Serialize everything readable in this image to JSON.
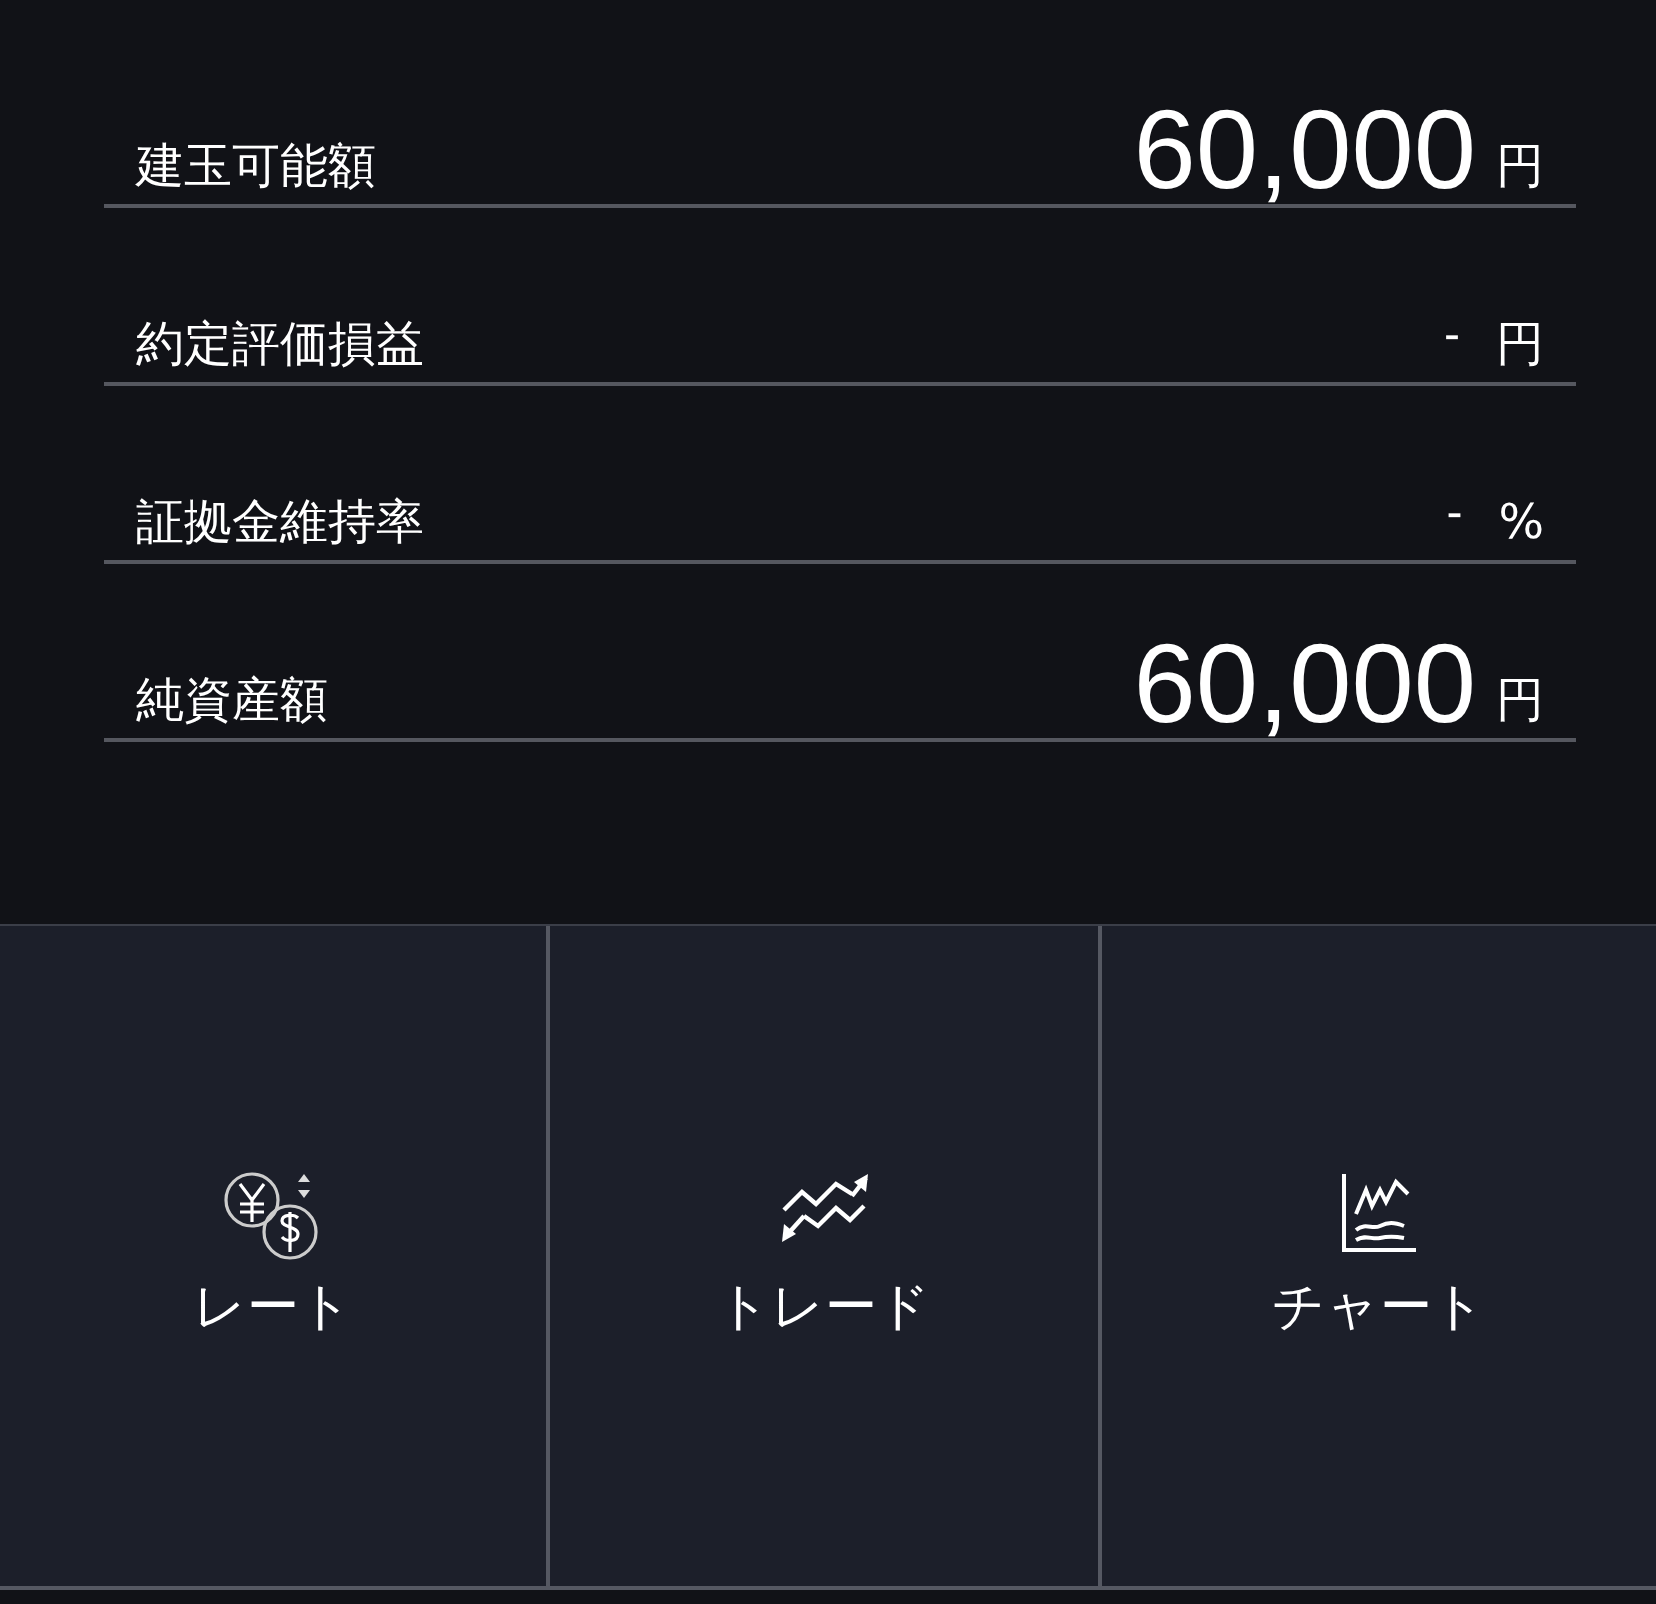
{
  "summary_rows": [
    {
      "label": "建玉可能額",
      "value": "60,000",
      "unit": "円",
      "kind": "large"
    },
    {
      "label": "約定評価損益",
      "value": "-",
      "unit": "円",
      "kind": "dash"
    },
    {
      "label": "証拠金維持率",
      "value": "-",
      "unit": "%",
      "kind": "dash"
    },
    {
      "label": "純資産額",
      "value": "60,000",
      "unit": "円",
      "kind": "large"
    }
  ],
  "menu_tiles": [
    {
      "label": "レート",
      "kind": "rate"
    },
    {
      "label": "トレード",
      "kind": "trade"
    },
    {
      "label": "チャート",
      "kind": "chart"
    }
  ]
}
